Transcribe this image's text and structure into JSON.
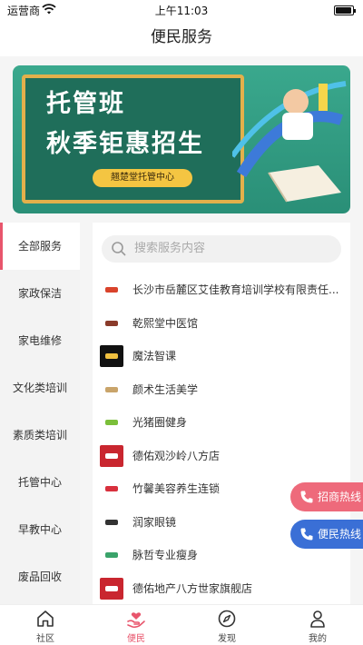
{
  "status_bar": {
    "carrier": "运营商",
    "time": "上午11:03"
  },
  "nav": {
    "title": "便民服务"
  },
  "banner": {
    "line1": "托管班",
    "line2": "秋季钜惠招生",
    "tag": "翘楚堂托管中心"
  },
  "sidebar": {
    "items": [
      {
        "label": "全部服务",
        "active": true
      },
      {
        "label": "家政保洁"
      },
      {
        "label": "家电维修"
      },
      {
        "label": "文化类培训"
      },
      {
        "label": "素质类培训"
      },
      {
        "label": "托管中心"
      },
      {
        "label": "早教中心"
      },
      {
        "label": "废品回收"
      }
    ]
  },
  "search": {
    "placeholder": "搜索服务内容"
  },
  "services": [
    {
      "name": "长沙市岳麓区艾佳教育培训学校有限责任...",
      "logo_bg": "#ffffff",
      "logo_fg": "#d9432b"
    },
    {
      "name": "乾熙堂中医馆",
      "logo_bg": "#ffffff",
      "logo_fg": "#8a3b2a"
    },
    {
      "name": "魔法智课",
      "logo_bg": "#111111",
      "logo_fg": "#f0c040"
    },
    {
      "name": "颜术生活美学",
      "logo_bg": "#ffffff",
      "logo_fg": "#c9a46a"
    },
    {
      "name": "光猪圈健身",
      "logo_bg": "#ffffff",
      "logo_fg": "#7bbf3a"
    },
    {
      "name": "德佑观沙岭八方店",
      "logo_bg": "#c9262f",
      "logo_fg": "#ffffff"
    },
    {
      "name": "竹馨美容养生连锁",
      "logo_bg": "#ffffff",
      "logo_fg": "#d8303d"
    },
    {
      "name": "润家眼镜",
      "logo_bg": "#ffffff",
      "logo_fg": "#333333"
    },
    {
      "name": "脉哲专业瘦身",
      "logo_bg": "#ffffff",
      "logo_fg": "#3aa36a"
    },
    {
      "name": "德佑地产八方世家旗舰店",
      "logo_bg": "#c9262f",
      "logo_fg": "#ffffff"
    }
  ],
  "hotlines": {
    "business": "招商热线",
    "civic": "便民热线"
  },
  "tabbar": {
    "items": [
      {
        "label": "社区",
        "icon": "home-icon"
      },
      {
        "label": "便民",
        "icon": "heart-hand-icon",
        "active": true
      },
      {
        "label": "发现",
        "icon": "compass-icon"
      },
      {
        "label": "我的",
        "icon": "person-icon"
      }
    ]
  },
  "colors": {
    "accent": "#e8556c",
    "blue": "#3a6fd6",
    "banner_green": "#2a8f77"
  }
}
